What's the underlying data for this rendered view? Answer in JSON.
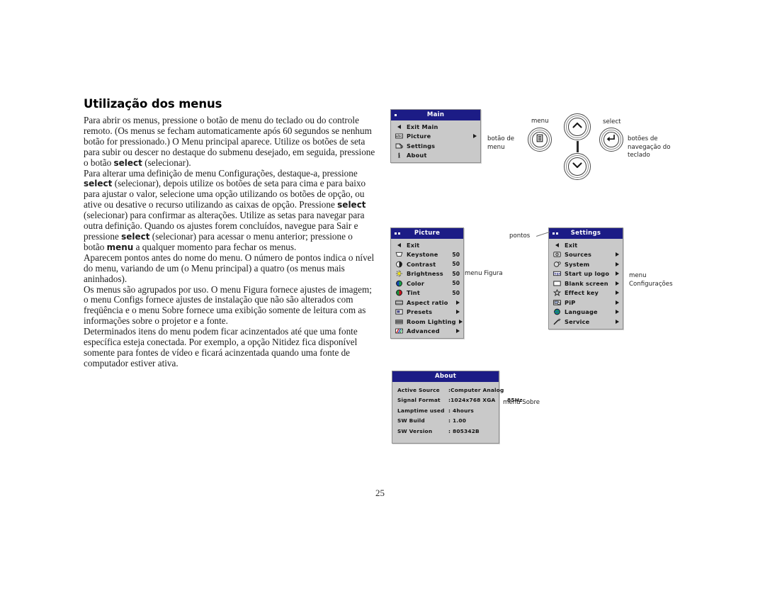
{
  "page": {
    "number": "25",
    "heading": "Utilização dos menus"
  },
  "body": {
    "paragraphs": [
      {
        "id": "p1",
        "runs": [
          {
            "t": "Para abrir os menus, pressione o botão de menu do teclado ou do controle remoto. (Os menus se fecham automaticamente após 60 segundos se nenhum botão for pressionado.) O Menu principal aparece. Utilize os botões de seta para subir ou descer no destaque do submenu desejado, em seguida, pressione o botão ",
            "b": false
          },
          {
            "t": "select",
            "b": true
          },
          {
            "t": " (selecionar).",
            "b": false
          }
        ]
      },
      {
        "id": "p2",
        "runs": [
          {
            "t": "Para alterar uma definição de menu Configurações, destaque-a, pressione ",
            "b": false
          },
          {
            "t": "select",
            "b": true
          },
          {
            "t": " (selecionar), depois utilize os botões de seta para cima e para baixo para ajustar o valor, selecione uma opção utilizando os botões de opção, ou ative ou desative o recurso utilizando as caixas de opção. Pressione ",
            "b": false
          },
          {
            "t": "select",
            "b": true
          },
          {
            "t": " (selecionar) para confirmar as alterações. Utilize as setas para navegar para outra definição. Quando os ajustes forem concluídos, navegue para Sair e pressione ",
            "b": false
          },
          {
            "t": "select",
            "b": true
          },
          {
            "t": " (selecionar) para acessar o menu anterior; pressione o",
            "b": false
          }
        ]
      },
      {
        "id": "p3",
        "runs": [
          {
            "t": "botão ",
            "b": false
          },
          {
            "t": "menu",
            "b": true
          },
          {
            "t": " a qualquer momento para fechar os menus.",
            "b": false
          }
        ]
      },
      {
        "id": "p4",
        "runs": [
          {
            "t": "Aparecem pontos antes do nome do menu. O número de pontos indica o nível do menu, variando de um (o Menu principal) a quatro (os menus mais aninhados).",
            "b": false
          }
        ]
      },
      {
        "id": "p5",
        "runs": [
          {
            "t": "Os menus são agrupados por uso. O menu Figura fornece ajustes de imagem; o menu Configs fornece ajustes de instalação que não são alterados com freqüência e o menu Sobre fornece uma exibição somente de leitura com as informações sobre o projetor e a fonte.",
            "b": false
          }
        ]
      },
      {
        "id": "p6",
        "runs": [
          {
            "t": "Determinados itens do menu podem ficar acinzentados até que uma fonte específica esteja conectada. Por exemplo, a opção Nitidez fica disponível somente para fontes de vídeo e ficará acinzentada quando uma fonte de computador estiver ativa.",
            "b": false
          }
        ]
      }
    ]
  },
  "osd": {
    "colors": {
      "title_bar": "#1c1c86",
      "title_text": "#ffffff",
      "body": "#c9c9c9",
      "text": "#141414"
    },
    "main": {
      "title": "Main",
      "level_dots": 1,
      "items": [
        {
          "label": "Exit Main",
          "icon": "back-arrow-icon",
          "value": "",
          "submenu": false
        },
        {
          "label": "Picture",
          "icon": "picture-icon",
          "value": "",
          "submenu": true
        },
        {
          "label": "Settings",
          "icon": "settings-icon",
          "value": "",
          "submenu": false
        },
        {
          "label": "About",
          "icon": "info-icon",
          "value": "",
          "submenu": false
        }
      ]
    },
    "picture": {
      "title": "Picture",
      "level_dots": 2,
      "items": [
        {
          "label": "Exit",
          "icon": "back-arrow-icon",
          "value": "",
          "submenu": false
        },
        {
          "label": "Keystone",
          "icon": "keystone-icon",
          "value": "50",
          "submenu": false
        },
        {
          "label": "Contrast",
          "icon": "contrast-icon",
          "value": "50",
          "submenu": false
        },
        {
          "label": "Brightness",
          "icon": "brightness-icon",
          "value": "50",
          "submenu": false
        },
        {
          "label": "Color",
          "icon": "color-icon",
          "value": "50",
          "submenu": false
        },
        {
          "label": "Tint",
          "icon": "tint-icon",
          "value": "50",
          "submenu": false
        },
        {
          "label": "Aspect ratio",
          "icon": "aspect-ratio-icon",
          "value": "",
          "submenu": true
        },
        {
          "label": "Presets",
          "icon": "presets-icon",
          "value": "",
          "submenu": true
        },
        {
          "label": "Room Lighting",
          "icon": "room-lighting-icon",
          "value": "",
          "submenu": true
        },
        {
          "label": "Advanced",
          "icon": "advanced-icon",
          "value": "",
          "submenu": true
        }
      ]
    },
    "settings": {
      "title": "Settings",
      "level_dots": 2,
      "items": [
        {
          "label": "Exit",
          "icon": "back-arrow-icon",
          "value": "",
          "submenu": false
        },
        {
          "label": "Sources",
          "icon": "sources-icon",
          "value": "",
          "submenu": true
        },
        {
          "label": "System",
          "icon": "system-icon",
          "value": "",
          "submenu": true
        },
        {
          "label": "Start up logo",
          "icon": "startup-logo-icon",
          "value": "",
          "submenu": true
        },
        {
          "label": "Blank screen",
          "icon": "blank-screen-icon",
          "value": "",
          "submenu": true
        },
        {
          "label": "Effect key",
          "icon": "effect-key-icon",
          "value": "",
          "submenu": true
        },
        {
          "label": "PiP",
          "icon": "pip-icon",
          "value": "",
          "submenu": true
        },
        {
          "label": "Language",
          "icon": "language-icon",
          "value": "",
          "submenu": true
        },
        {
          "label": "Service",
          "icon": "service-icon",
          "value": "",
          "submenu": true
        }
      ]
    },
    "about": {
      "title": "About",
      "rows": [
        {
          "key": "Active Source",
          "sep": ":",
          "value": "Computer Analog"
        },
        {
          "key": "Signal Format",
          "sep": ":",
          "value": "1024x768 XGA      85Hz"
        },
        {
          "key": "Lamptime used",
          "sep": ":",
          "value": "4hours"
        },
        {
          "key": "SW Build",
          "sep": ":",
          "value": "1.00"
        },
        {
          "key": "SW Version",
          "sep": ":",
          "value": "805342B"
        }
      ]
    }
  },
  "keypad": {
    "menu_top_label": "menu",
    "select_top_label": "select",
    "menu_caption": "botão de\nmenu",
    "nav_caption": "botões de\nnavegação  do\nteclado",
    "menu_icon": "menu-button-icon",
    "select_icon": "enter-arrow-icon",
    "up_icon": "chevron-up-icon",
    "down_icon": "chevron-down-icon"
  },
  "callouts": {
    "pontos": "pontos",
    "menu_figura": "menu Figura",
    "menu_configuracoes": "menu\nConfigurações",
    "menu_sobre": "menu Sobre"
  }
}
